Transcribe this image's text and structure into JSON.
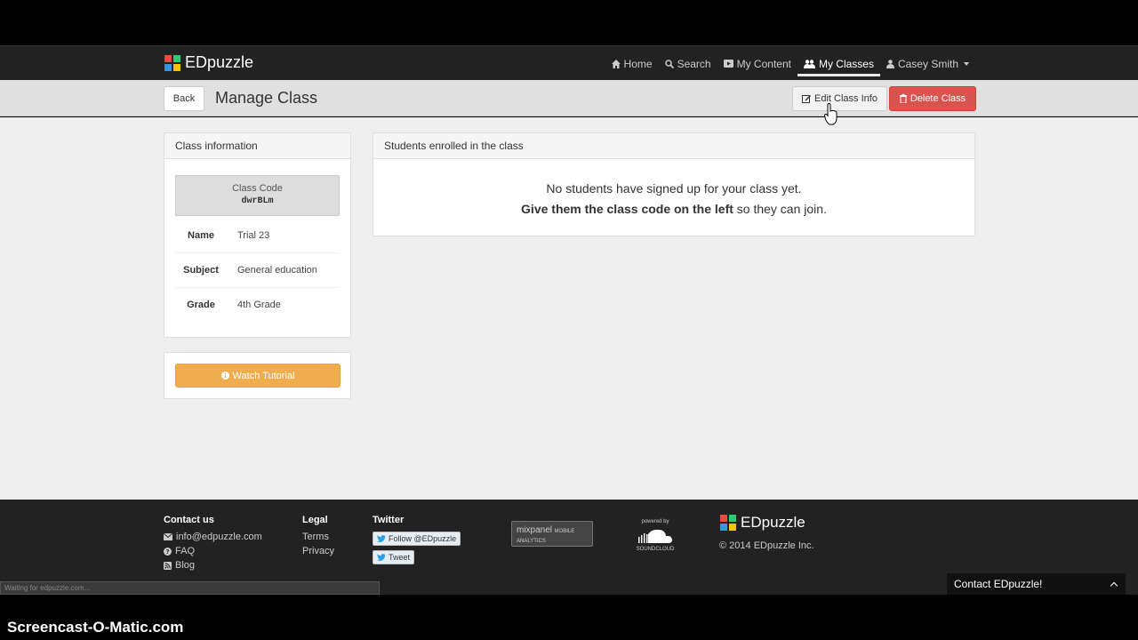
{
  "navbar": {
    "brand": "EDpuzzle",
    "items": [
      {
        "label": "Home",
        "icon": "home-icon"
      },
      {
        "label": "Search",
        "icon": "search-icon"
      },
      {
        "label": "My Content",
        "icon": "video-icon"
      },
      {
        "label": "My Classes",
        "icon": "users-icon"
      },
      {
        "label": "Casey Smith",
        "icon": "user-icon"
      }
    ]
  },
  "subheader": {
    "back_label": "Back",
    "title": "Manage Class",
    "edit_label": "Edit Class Info",
    "delete_label": "Delete Class"
  },
  "class_info": {
    "heading": "Class information",
    "code_label": "Class Code",
    "code_value": "dwrBLm",
    "rows": [
      {
        "key": "Name",
        "value": "Trial 23"
      },
      {
        "key": "Subject",
        "value": "General education"
      },
      {
        "key": "Grade",
        "value": "4th Grade"
      }
    ]
  },
  "tutorial": {
    "label": "Watch Tutorial"
  },
  "students": {
    "heading": "Students enrolled in the class",
    "line1": "No students have signed up for your class yet.",
    "line2_bold": "Give them the class code on the left",
    "line2_rest": " so they can join."
  },
  "footer": {
    "contact_head": "Contact us",
    "email": "info@edpuzzle.com",
    "faq": "FAQ",
    "blog": "Blog",
    "legal_head": "Legal",
    "terms": "Terms",
    "privacy": "Privacy",
    "twitter_head": "Twitter",
    "follow": "Follow @EDpuzzle",
    "tweet": "Tweet",
    "mixpanel_name": "mixpanel",
    "mixpanel_tag": "MOBILE ANALYTICS",
    "powered_by": "powered by",
    "soundcloud": "SOUNDCLOUD",
    "brand": "EDpuzzle",
    "copyright": "© 2014 EDpuzzle Inc.",
    "status": "Waiting for edpuzzle.com...",
    "contact_tab": "Contact EDpuzzle!"
  },
  "watermark": "Screencast-O-Matic.com",
  "colors": {
    "navbar_bg": "#222222",
    "delete": "#d9534f",
    "tutorial": "#f0ad4e"
  }
}
